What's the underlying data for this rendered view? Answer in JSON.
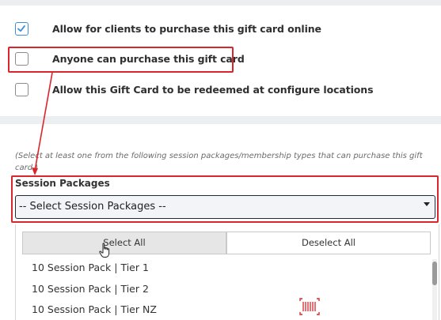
{
  "options": [
    {
      "label": "Allow for clients to purchase this gift card online",
      "checked": true
    },
    {
      "label": "Anyone can purchase this gift card",
      "checked": false
    },
    {
      "label": "Allow this Gift Card to be redeemed at configure locations",
      "checked": false
    }
  ],
  "helper_text": "(Select at least one from the following session packages/membership types that can purchase this gift card.)",
  "session_packages": {
    "label": "Session Packages",
    "selected": "-- Select Session Packages --"
  },
  "dropdown": {
    "select_all": "Select All",
    "deselect_all": "Deselect All",
    "items": [
      "10 Session Pack | Tier 1",
      "10 Session Pack | Tier 2",
      "10 Session Pack | Tier NZ"
    ]
  },
  "colors": {
    "annotation_red": "#d9262c",
    "checkbox_blue": "#3f8fd8"
  },
  "icons": {
    "checkbox_check": "check-icon",
    "cursor": "hand-pointer-icon",
    "widget": "barcode-scan-icon"
  }
}
